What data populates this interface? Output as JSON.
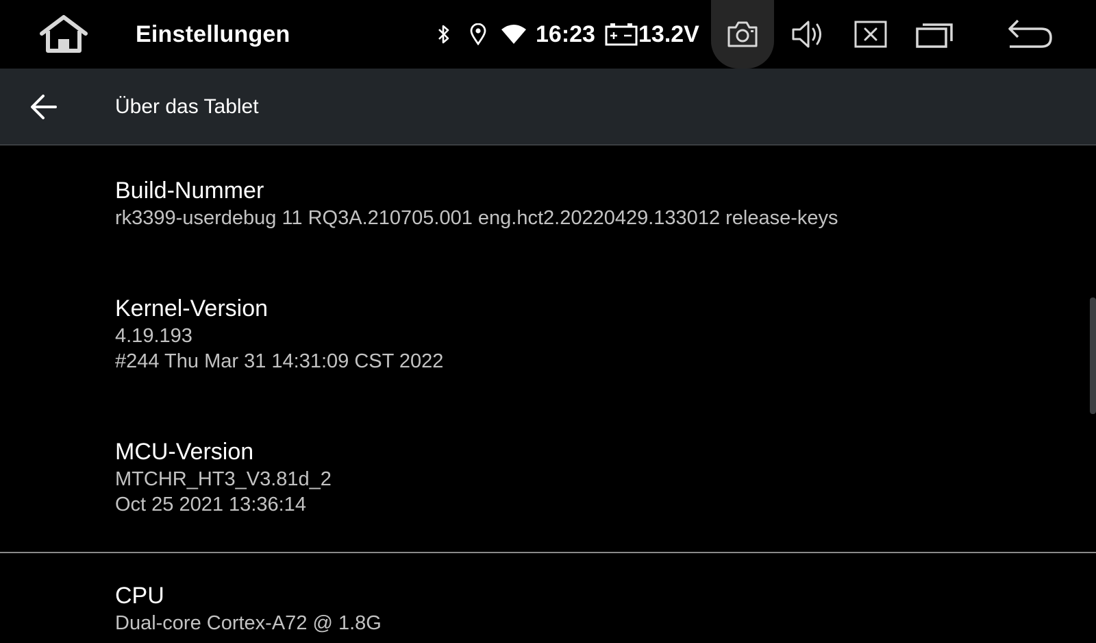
{
  "statusbar": {
    "app_title": "Einstellungen",
    "clock": "16:23",
    "voltage": "13.2V",
    "icons": [
      "home-icon",
      "bluetooth-icon",
      "location-icon",
      "wifi-icon",
      "battery-icon",
      "camera-icon",
      "volume-icon",
      "close-box-icon",
      "recents-icon",
      "back-arrow-icon"
    ]
  },
  "header": {
    "title": "Über das Tablet",
    "back_icon": "arrow-left-icon"
  },
  "items": [
    {
      "title": "Build-Nummer",
      "lines": [
        "rk3399-userdebug 11 RQ3A.210705.001 eng.hct2.20220429.133012 release-keys"
      ]
    },
    {
      "title": "Kernel-Version",
      "lines": [
        "4.19.193",
        "#244 Thu Mar 31 14:31:09 CST 2022"
      ]
    },
    {
      "title": "MCU-Version",
      "lines": [
        "MTCHR_HT3_V3.81d_2",
        "Oct 25 2021 13:36:14"
      ]
    },
    {
      "title": "CPU",
      "lines": [
        "Dual-core Cortex-A72 @ 1.8G"
      ]
    }
  ],
  "colors": {
    "background": "#000000",
    "header_bg": "#22262a",
    "primary_text": "#ffffff",
    "secondary_text": "#c3c3c3",
    "camera_highlight": "#262626"
  }
}
